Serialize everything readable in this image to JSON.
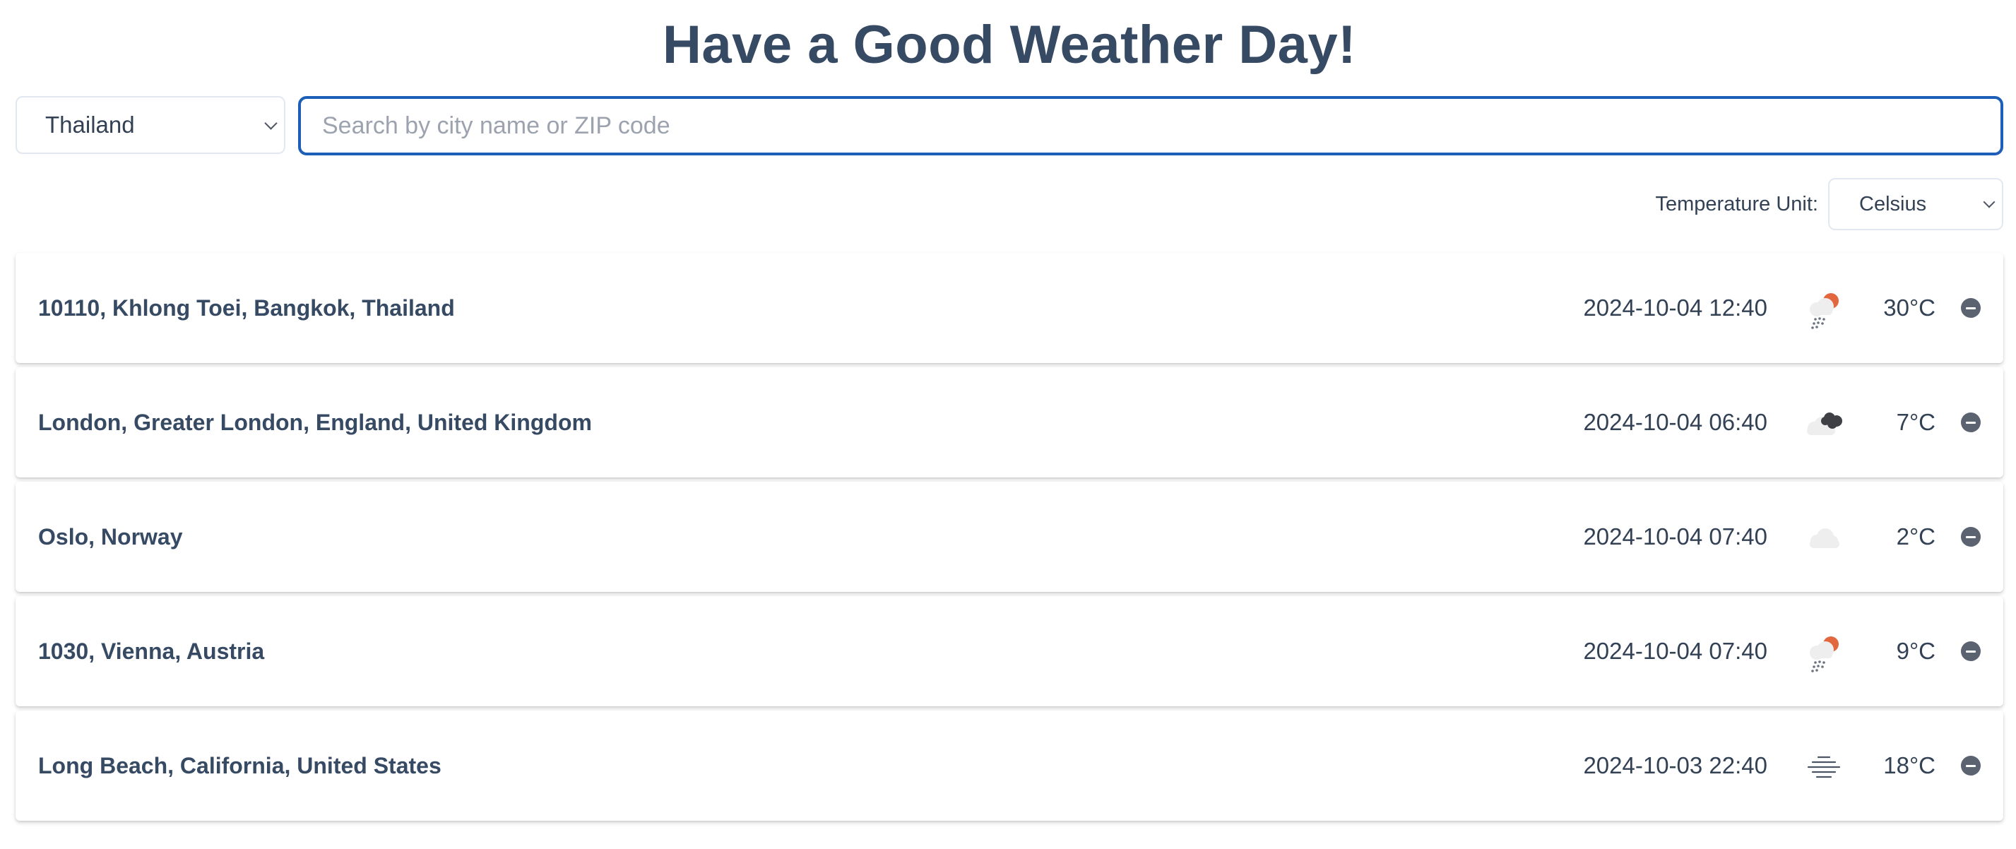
{
  "header": {
    "title": "Have a Good Weather Day!"
  },
  "search": {
    "country_selected": "Thailand",
    "placeholder": "Search by city name or ZIP code",
    "value": ""
  },
  "settings": {
    "temperature_unit_label": "Temperature Unit:",
    "temperature_unit_selected": "Celsius"
  },
  "locations": [
    {
      "name": "10110, Khlong Toei, Bangkok, Thailand",
      "datetime": "2024-10-04 12:40",
      "temperature": "30°C",
      "icon": "sun-cloud-rain-icon"
    },
    {
      "name": "London, Greater London, England, United Kingdom",
      "datetime": "2024-10-04 06:40",
      "temperature": "7°C",
      "icon": "dark-clouds-icon"
    },
    {
      "name": "Oslo, Norway",
      "datetime": "2024-10-04 07:40",
      "temperature": "2°C",
      "icon": "cloud-icon"
    },
    {
      "name": "1030, Vienna, Austria",
      "datetime": "2024-10-04 07:40",
      "temperature": "9°C",
      "icon": "sun-cloud-rain-icon"
    },
    {
      "name": "Long Beach, California, United States",
      "datetime": "2024-10-03 22:40",
      "temperature": "18°C",
      "icon": "fog-icon"
    }
  ],
  "colors": {
    "title": "#374a64",
    "focus_border": "#1d5fb8",
    "remove_button": "#5b6270",
    "sun_accent": "#e2673f"
  }
}
